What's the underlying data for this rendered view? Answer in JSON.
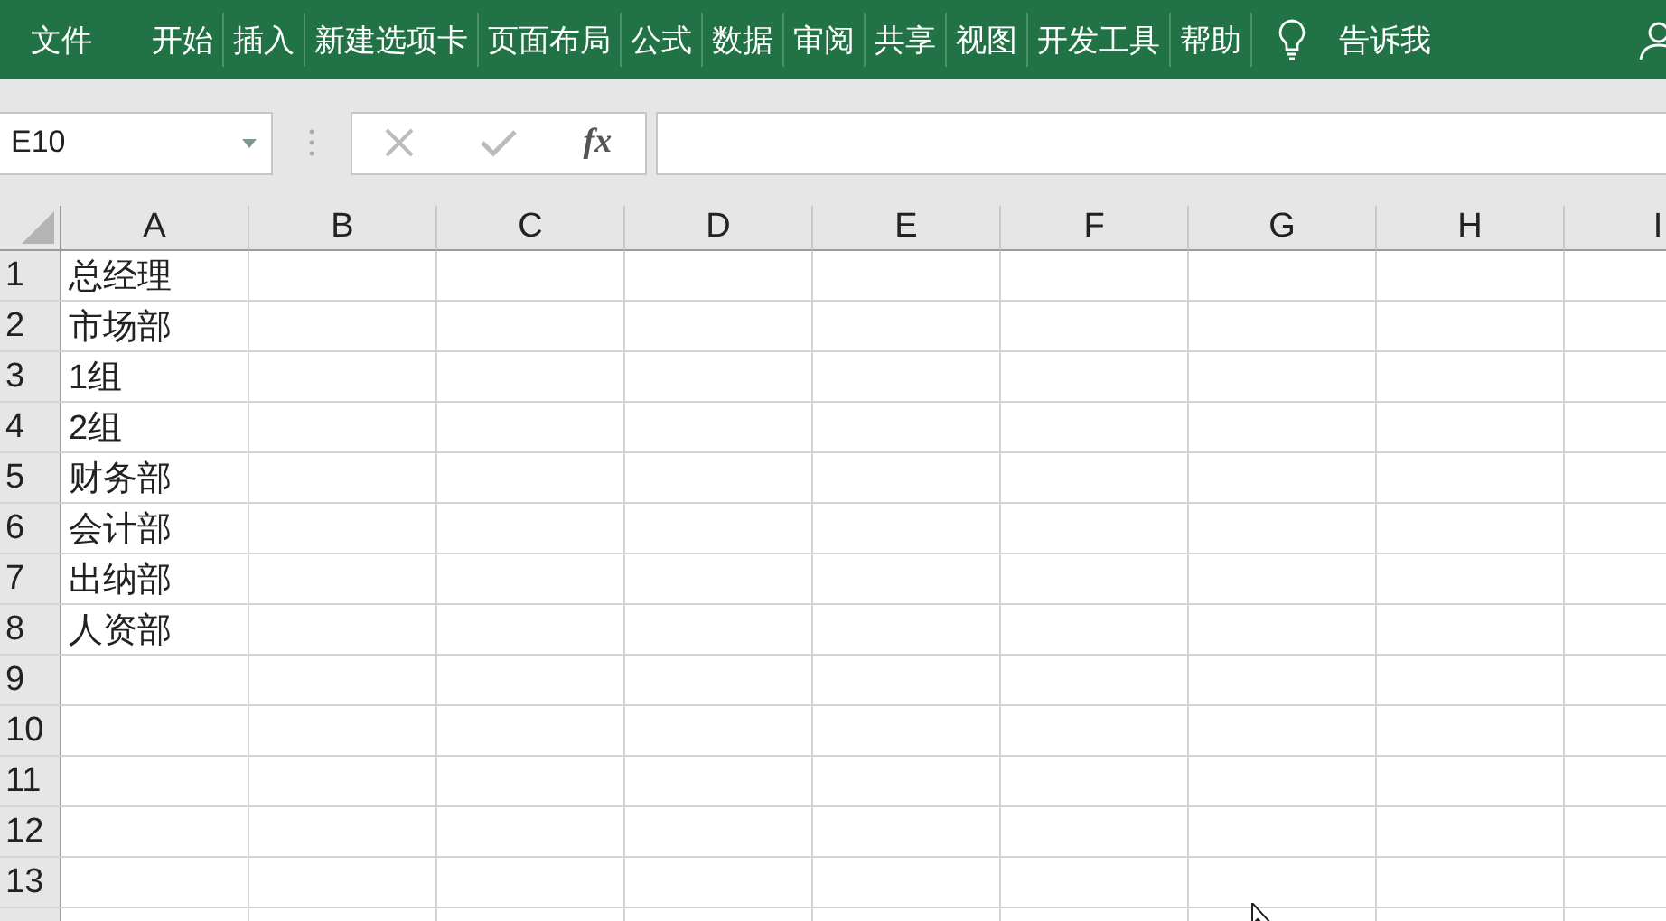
{
  "ribbon": {
    "file_tab": "文件",
    "tabs": [
      {
        "label": "开始",
        "selected": false
      },
      {
        "label": "插入",
        "selected": false
      },
      {
        "label": "新建选项卡",
        "selected": false
      },
      {
        "label": "页面布局",
        "selected": false
      },
      {
        "label": "公式",
        "selected": false
      },
      {
        "label": "数据",
        "selected": false
      },
      {
        "label": "审阅",
        "selected": false
      },
      {
        "label": "共享",
        "selected": false
      },
      {
        "label": "视图",
        "selected": false
      },
      {
        "label": "开发工具",
        "selected": false
      },
      {
        "label": "帮助",
        "selected": false
      }
    ],
    "tell_me": "告诉我"
  },
  "name_box": {
    "value": "E10"
  },
  "formula_bar": {
    "function_label": "fx"
  },
  "columns": [
    "A",
    "B",
    "C",
    "D",
    "E",
    "F",
    "G",
    "H",
    "I"
  ],
  "rows": [
    {
      "number": "1",
      "cells": [
        "总经理"
      ]
    },
    {
      "number": "2",
      "cells": [
        "市场部"
      ]
    },
    {
      "number": "3",
      "cells": [
        "1组"
      ]
    },
    {
      "number": "4",
      "cells": [
        "2组"
      ]
    },
    {
      "number": "5",
      "cells": [
        "财务部"
      ]
    },
    {
      "number": "6",
      "cells": [
        "会计部"
      ]
    },
    {
      "number": "7",
      "cells": [
        "出纳部"
      ]
    },
    {
      "number": "8",
      "cells": [
        "人资部"
      ]
    },
    {
      "number": "9",
      "cells": []
    },
    {
      "number": "10",
      "cells": []
    },
    {
      "number": "11",
      "cells": []
    },
    {
      "number": "12",
      "cells": []
    },
    {
      "number": "13",
      "cells": []
    }
  ]
}
